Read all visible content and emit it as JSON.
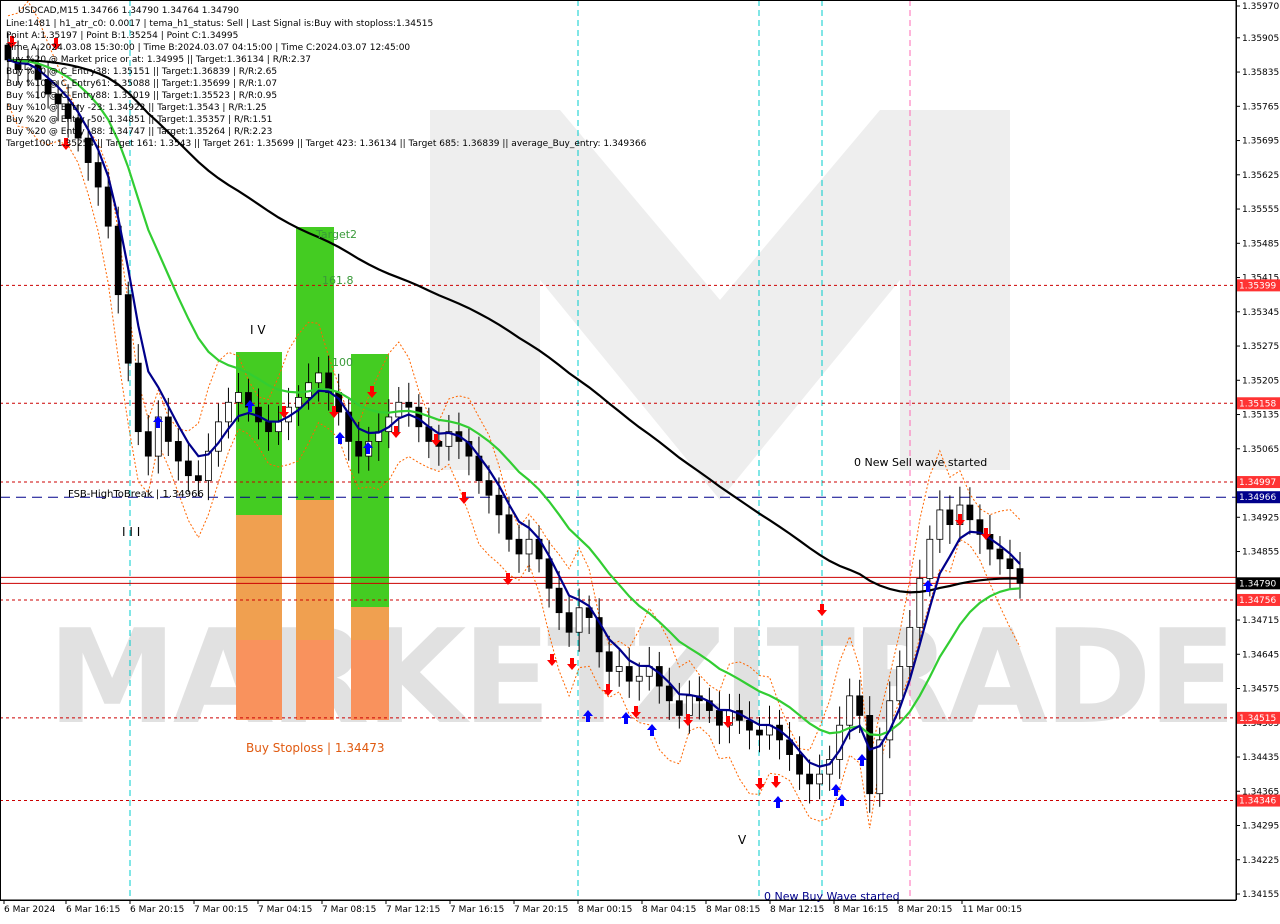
{
  "header": {
    "title": "USDCAD,M15  1.34766 1.34790 1.34764 1.34790",
    "lines": [
      "Line:1481 | h1_atr_c0: 0.0017 | tema_h1_status: Sell | Last Signal is:Buy with stoploss:1.34515",
      "Point A:1.35197 | Point B:1.35254 | Point C:1.34995",
      "Time A:2024.03.08 15:30:00 | Time B:2024.03.07 04:15:00 | Time C:2024.03.07 12:45:00",
      "Buy %20 @ Market price or at: 1.34995 || Target:1.36134 | R/R:2.37",
      "Buy %10 @ C_Entry38: 1.35151 || Target:1.36839 | R/R:2.65",
      "Buy %10 @ C_Entry61: 1.35088 || Target:1.35699 | R/R:1.07",
      "Buy %10 @ C_Entry88: 1.35019 || Target:1.35523 | R/R:0.95",
      "Buy %10 @ Entry -23: 1.34922 || Target:1.3543 | R/R:1.25",
      "Buy %20 @ Entry -50: 1.34851 || Target:1.35357 | R/R:1.51",
      "Buy %20 @ Entry -88: 1.34747 || Target:1.35264 | R/R:2.23",
      "Target100: 1.35254 || Target 161: 1.3543 || Target 261: 1.35699 || Target 423: 1.36134 || Target 685: 1.36839 || average_Buy_entry: 1.349366"
    ]
  },
  "watermark": "MARKETZITRADE",
  "annotations": {
    "target2": "Target2",
    "fib161": "161.8",
    "fib100": "100",
    "wave_iv": "I V",
    "wave_iii": "I I I",
    "wave_v": "V",
    "fsb": "FSB-HighToBreak | 1.34966",
    "buy_stoploss": "Buy Stoploss | 1.34473",
    "new_sell": "0 New Sell wave started",
    "new_buy": "0 New Buy Wave started"
  },
  "colors": {
    "background": "#ffffff",
    "candle": "#000000",
    "ema_fast": "#00008b",
    "ema_mid": "#32cd32",
    "ema_slow": "#000000",
    "level_red": "#cc0000",
    "fsb_blue": "#00008b",
    "vline_cyan": "#00cccc",
    "vline_pink": "#ff69b4",
    "band_orange": "#ff6600",
    "zone_green": "#44cc22",
    "zone_orange": "#f0a050",
    "zone_salmon": "#ff8866",
    "arrow_up": "#0000ff",
    "arrow_down": "#ff0000",
    "price_tag": "#ff3333"
  },
  "chart_data": {
    "type": "candlestick",
    "symbol": "USDCAD",
    "timeframe": "M15",
    "ylim": [
      1.34155,
      1.3597
    ],
    "y_ticks": [
      "1.35970",
      "1.35905",
      "1.35835",
      "1.35765",
      "1.35695",
      "1.35625",
      "1.35555",
      "1.35485",
      "1.35415",
      "1.35345",
      "1.35275",
      "1.35205",
      "1.35135",
      "1.35065",
      "1.34995",
      "1.34925",
      "1.34855",
      "1.34785",
      "1.34715",
      "1.34645",
      "1.34575",
      "1.34505",
      "1.34435",
      "1.34365",
      "1.34295",
      "1.34225",
      "1.34155"
    ],
    "x_ticks": [
      "6 Mar 2024",
      "6 Mar 16:15",
      "6 Mar 20:15",
      "7 Mar 00:15",
      "7 Mar 04:15",
      "7 Mar 08:15",
      "7 Mar 12:15",
      "7 Mar 16:15",
      "7 Mar 20:15",
      "8 Mar 00:15",
      "8 Mar 04:15",
      "8 Mar 08:15",
      "8 Mar 12:15",
      "8 Mar 16:15",
      "8 Mar 20:15",
      "11 Mar 00:15"
    ],
    "price_levels": [
      {
        "value": 1.35399,
        "label": "1.35399",
        "style": "dotted"
      },
      {
        "value": 1.35158,
        "label": "1.35158",
        "style": "dotted"
      },
      {
        "value": 1.34997,
        "label": "1.34997",
        "style": "dotted"
      },
      {
        "value": 1.34966,
        "label": "1.34966",
        "style": "dashed-blue"
      },
      {
        "value": 1.3479,
        "label": "1.34790",
        "style": "current"
      },
      {
        "value": 1.34756,
        "label": "1.34756",
        "style": "dotted"
      },
      {
        "value": 1.34515,
        "label": "1.34515",
        "style": "dotted"
      },
      {
        "value": 1.34346,
        "label": "1.34346",
        "style": "dotted"
      }
    ],
    "close_series": [
      1.3586,
      1.3584,
      1.3585,
      1.3582,
      1.3579,
      1.3577,
      1.3574,
      1.357,
      1.3565,
      1.356,
      1.3552,
      1.3538,
      1.3524,
      1.351,
      1.3505,
      1.3513,
      1.3508,
      1.3504,
      1.3501,
      1.35,
      1.3506,
      1.3512,
      1.3516,
      1.3518,
      1.3515,
      1.3512,
      1.351,
      1.3512,
      1.3515,
      1.3517,
      1.352,
      1.3522,
      1.3518,
      1.3514,
      1.3508,
      1.3505,
      1.3508,
      1.351,
      1.3513,
      1.3516,
      1.3515,
      1.3511,
      1.3508,
      1.3507,
      1.351,
      1.3508,
      1.3505,
      1.35,
      1.3497,
      1.3493,
      1.3488,
      1.3485,
      1.3488,
      1.3484,
      1.3478,
      1.3473,
      1.3469,
      1.3474,
      1.3472,
      1.3465,
      1.3461,
      1.3462,
      1.3459,
      1.346,
      1.3462,
      1.3458,
      1.3455,
      1.3452,
      1.3456,
      1.3455,
      1.3453,
      1.345,
      1.3453,
      1.3451,
      1.3449,
      1.3448,
      1.345,
      1.3447,
      1.3444,
      1.344,
      1.3438,
      1.344,
      1.3443,
      1.345,
      1.3456,
      1.3452,
      1.3436,
      1.3447,
      1.3455,
      1.3462,
      1.347,
      1.348,
      1.3488,
      1.3494,
      1.3491,
      1.3495,
      1.3492,
      1.3489,
      1.3486,
      1.3484,
      1.3482,
      1.3479
    ]
  }
}
